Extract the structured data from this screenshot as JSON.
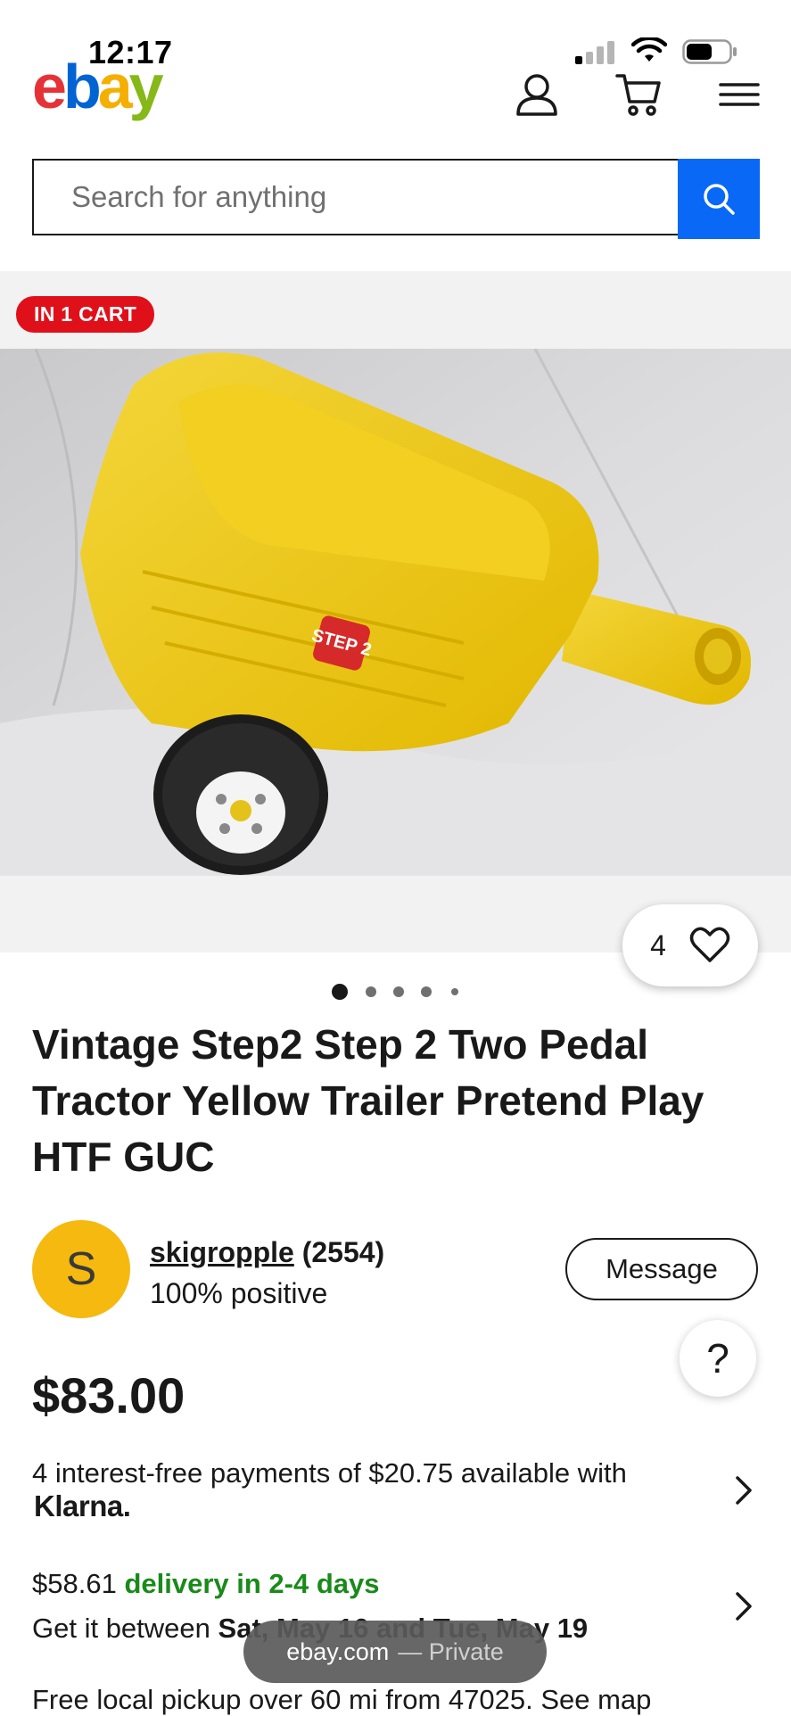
{
  "status_bar": {
    "time": "12:17"
  },
  "header": {
    "logo": {
      "e": "e",
      "b": "b",
      "a": "a",
      "y": "y"
    },
    "icons": [
      "user-icon",
      "cart-icon",
      "menu-icon"
    ]
  },
  "search": {
    "placeholder": "Search for anything"
  },
  "gallery": {
    "badge": "IN 1 CART",
    "watch_count": "4",
    "dots_count": 5,
    "active_dot": 0,
    "photo_logo": "STEP 2"
  },
  "listing": {
    "title": "Vintage Step2 Step 2 Two Pedal Tractor Yellow Trailer Pretend Play HTF GUC"
  },
  "seller": {
    "initial": "S",
    "name": "skigropple",
    "feedback": "(2554)",
    "positive": "100% positive",
    "message_label": "Message",
    "help_label": "?"
  },
  "price": {
    "amount": "$83.00",
    "klarna_text": "4 interest-free payments of $20.75 available with",
    "klarna_brand": "Klarna."
  },
  "shipping": {
    "cost": "$58.61",
    "delivery": "delivery in 2-4 days",
    "window_prefix": "Get it between",
    "window_dates": "Sat, May 16 and Tue, May 19",
    "pickup": "Free local pickup over 60 mi from 47025. See map"
  },
  "toast": {
    "domain": "ebay.com",
    "suffix": "— Private"
  },
  "colors": {
    "accent": "#0968f6",
    "badge": "#e0101a",
    "green": "#1a8a1a",
    "avatar": "#f5b90f"
  }
}
